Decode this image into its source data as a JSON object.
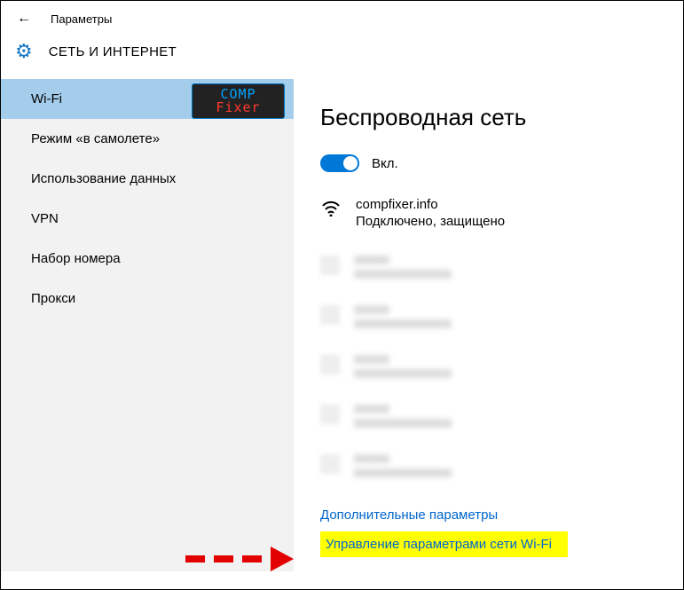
{
  "titlebar": {
    "title": "Параметры"
  },
  "header": {
    "title": "СЕТЬ И ИНТЕРНЕТ"
  },
  "sidebar": {
    "items": [
      {
        "label": "Wi-Fi",
        "selected": true
      },
      {
        "label": "Режим «в самолете»"
      },
      {
        "label": "Использование данных"
      },
      {
        "label": "VPN"
      },
      {
        "label": "Набор номера"
      },
      {
        "label": "Прокси"
      }
    ]
  },
  "logo": {
    "line1": "comp",
    "line2": "Fixer"
  },
  "main": {
    "heading": "Беспроводная сеть",
    "toggle_label": "Вкл.",
    "network": {
      "name": "compfixer.info",
      "status": "Подключено, защищено"
    },
    "advanced_link": "Дополнительные параметры",
    "manage_link": "Управление параметрами сети Wi-Fi"
  }
}
